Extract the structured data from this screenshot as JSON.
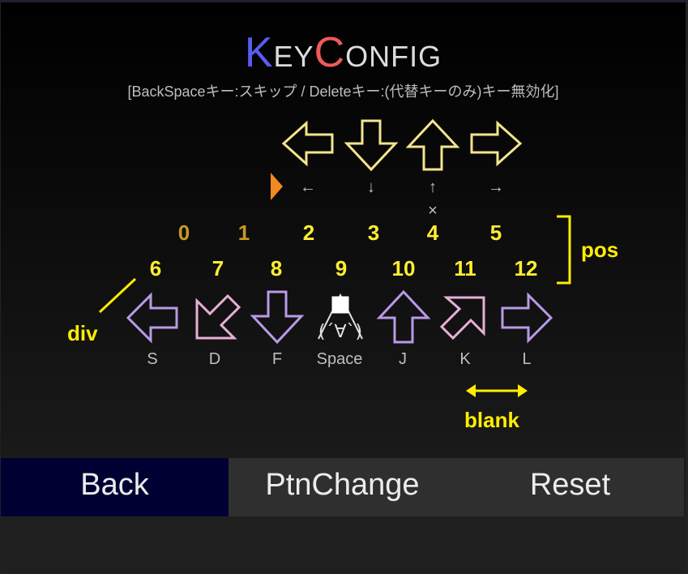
{
  "title": {
    "c1": "K",
    "r1": "EY",
    "c2": "C",
    "r2": "ONFIG"
  },
  "subtitle": "[BackSpaceキー:スキップ / Deleteキー:(代替キーのみ)キー無効化]",
  "colors": {
    "title_k": "#5a5cf0",
    "title_c": "#ef5a5a",
    "top_arrow": "#f2e58c",
    "bottom_arrow": "#b99ae6",
    "bottom_arrow_pink": "#e6b0d6",
    "number_dim": "#c99a1e",
    "number_bright": "#ffee30",
    "annotation": "#ffee00",
    "cursor": "#f08a22",
    "back_button": "#000033",
    "button_bar": "#2f2f2f"
  },
  "top_row": {
    "arrows": [
      "left-arrow-icon",
      "down-arrow-icon",
      "up-arrow-icon",
      "right-arrow-icon"
    ],
    "labels": [
      "←",
      "↓",
      "↑",
      "→"
    ],
    "alt_mark": "×"
  },
  "pos_row1": [
    "0",
    "1",
    "2",
    "3",
    "4",
    "5"
  ],
  "pos_row2": [
    "6",
    "7",
    "8",
    "9",
    "10",
    "11",
    "12"
  ],
  "bottom_row": {
    "arrows": [
      "left-arrow-icon",
      "down-left-arrow-icon",
      "down-arrow-icon",
      "onigiri-icon",
      "up-arrow-icon",
      "up-right-arrow-icon",
      "right-arrow-icon"
    ],
    "labels": [
      "S",
      "D",
      "F",
      "Space",
      "J",
      "K",
      "L"
    ],
    "onigiri_face": "(´∀`)"
  },
  "annotations": {
    "pos": "pos",
    "div": "div",
    "blank": "blank"
  },
  "buttons": {
    "back": "Back",
    "ptn_change": "PtnChange",
    "reset": "Reset"
  }
}
